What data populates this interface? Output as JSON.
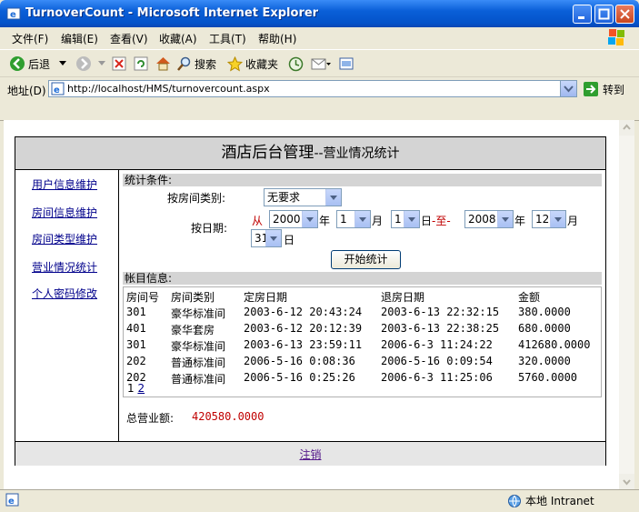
{
  "window": {
    "title": "TurnoverCount - Microsoft Internet Explorer"
  },
  "menu": {
    "items": [
      "文件(F)",
      "编辑(E)",
      "查看(V)",
      "收藏(A)",
      "工具(T)",
      "帮助(H)"
    ]
  },
  "toolbar": {
    "back_label": "后退",
    "search_label": "搜索",
    "favorites_label": "收藏夹"
  },
  "address": {
    "label": "地址(D)",
    "url": "http://localhost/HMS/turnovercount.aspx",
    "go_label": "转到"
  },
  "header": {
    "main": "酒店后台管理",
    "sub": "--营业情况统计"
  },
  "nav": {
    "items": [
      "用户信息维护",
      "房间信息维护",
      "房间类型维护",
      "营业情况统计",
      "个人密码修改"
    ]
  },
  "filter": {
    "section_title": "统计条件:",
    "room_type_label": "按房间类别:",
    "room_type_value": "无要求",
    "date_label": "按日期:",
    "from_label": "从",
    "from_year": "2000",
    "from_month": "1",
    "from_day": "1",
    "to_year": "2008",
    "to_month": "12",
    "to_day": "31",
    "year_unit": "年",
    "month_unit": "月",
    "day_unit": "日",
    "to_label": "-至-",
    "submit_label": "开始统计"
  },
  "account": {
    "section_title": "帐目信息:",
    "columns": [
      "房间号",
      "房间类别",
      "定房日期",
      "退房日期",
      "金额"
    ],
    "rows": [
      [
        "301",
        "豪华标准间",
        "2003-6-12 20:43:24",
        "2003-6-13 22:32:15",
        "380.0000"
      ],
      [
        "401",
        "豪华套房",
        "2003-6-12 20:12:39",
        "2003-6-13 22:38:25",
        "680.0000"
      ],
      [
        "301",
        "豪华标准间",
        "2003-6-13 23:59:11",
        "2006-6-3 11:24:22",
        "412680.0000"
      ],
      [
        "202",
        "普通标准间",
        "2006-5-16 0:08:36",
        "2006-5-16 0:09:54",
        "320.0000"
      ],
      [
        "202",
        "普通标准间",
        "2006-5-16 0:25:26",
        "2006-6-3 11:25:06",
        "5760.0000"
      ]
    ],
    "pages": [
      "1",
      "2"
    ],
    "total_label": "总营业额:",
    "total_value": "420580.0000"
  },
  "footer": {
    "logout_label": "注销"
  },
  "status": {
    "zone": "本地 Intranet"
  },
  "colors": {
    "titlebar": "#0a5fd8",
    "highlight_red": "#c00000",
    "link": "#00008b",
    "section_bg": "#d4d4d4"
  }
}
